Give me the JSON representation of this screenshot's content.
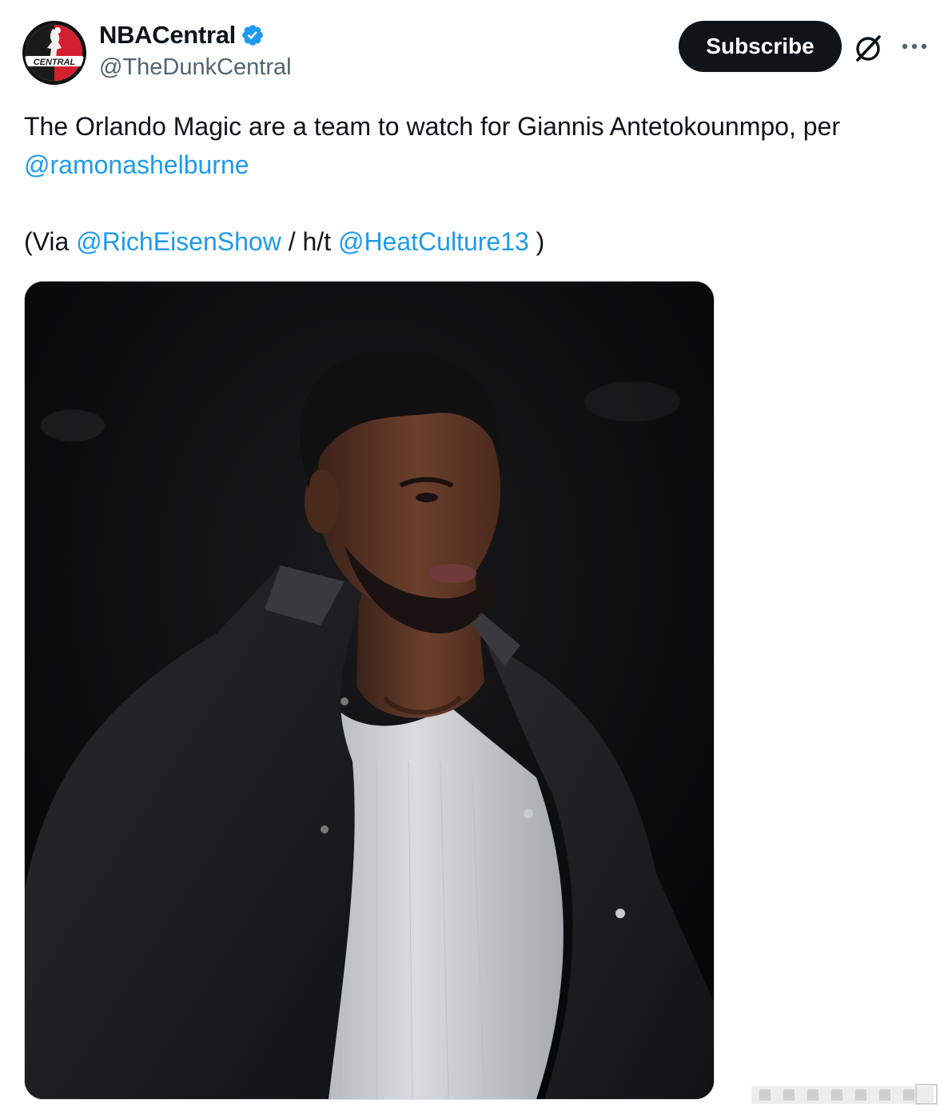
{
  "tweet": {
    "author": {
      "display_name": "NBACentral",
      "handle": "@TheDunkCentral",
      "verified": true,
      "avatar_text": "CENTRAL"
    },
    "actions": {
      "subscribe_label": "Subscribe",
      "grok_icon": "grok-icon",
      "more_icon": "more-icon"
    },
    "text": {
      "line1": "The Orlando Magic are a team to watch for Giannis Antetokounmpo, per",
      "mention1": "@ramonashelburne",
      "via_prefix": "(Via",
      "mention2": "@RichEisenShow",
      "ht": "/ h/t",
      "mention3": "@HeatCulture13",
      "close": ")"
    },
    "media": {
      "type": "photo"
    }
  },
  "colors": {
    "text": "#0f1419",
    "secondary": "#536471",
    "link": "#1d9bf0",
    "verified_badge": "#1d9bf0",
    "subscribe_bg": "#0f1419",
    "media_border": "#cfd9de"
  }
}
